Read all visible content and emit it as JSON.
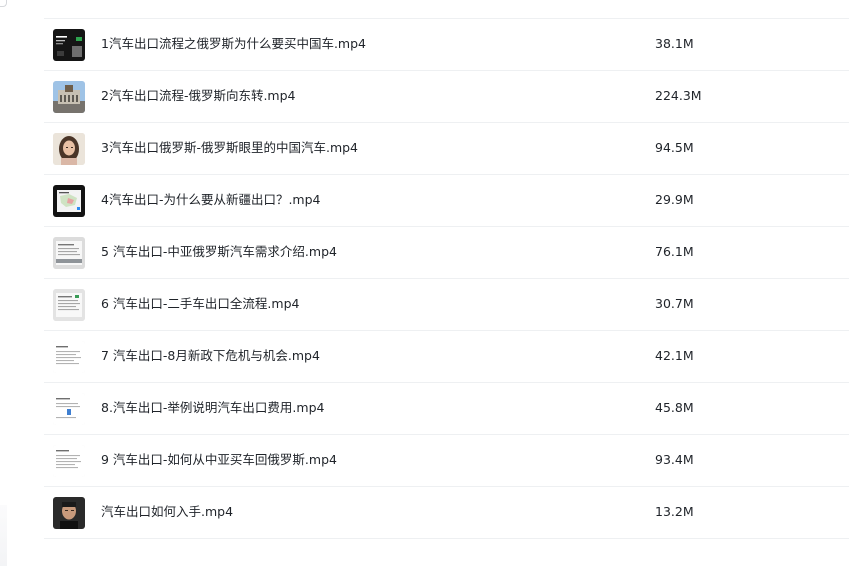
{
  "files": [
    {
      "name": "1汽车出口流程之俄罗斯为什么要买中国车.mp4",
      "size": "38.1M",
      "thumbnail": "dark-slide-thumbnail"
    },
    {
      "name": "2汽车出口流程-俄罗斯向东转.mp4",
      "size": "224.3M",
      "thumbnail": "building-photo-thumbnail"
    },
    {
      "name": "3汽车出口俄罗斯-俄罗斯眼里的中国汽车.mp4",
      "size": "94.5M",
      "thumbnail": "woman-portrait-thumbnail"
    },
    {
      "name": "4汽车出口-为什么要从新疆出口？.mp4",
      "size": "29.9M",
      "thumbnail": "map-slide-thumbnail"
    },
    {
      "name": "5 汽车出口-中亚俄罗斯汽车需求介绍.mp4",
      "size": "76.1M",
      "thumbnail": "document-slide-thumbnail"
    },
    {
      "name": "6 汽车出口-二手车出口全流程.mp4",
      "size": "30.7M",
      "thumbnail": "document-slide-thumbnail"
    },
    {
      "name": "7 汽车出口-8月新政下危机与机会.mp4",
      "size": "42.1M",
      "thumbnail": "text-slide-thumbnail"
    },
    {
      "name": "8.汽车出口-举例说明汽车出口费用.mp4",
      "size": "45.8M",
      "thumbnail": "text-slide-thumbnail"
    },
    {
      "name": "9 汽车出口-如何从中亚买车回俄罗斯.mp4",
      "size": "93.4M",
      "thumbnail": "text-slide-thumbnail"
    },
    {
      "name": "汽车出口如何入手.mp4",
      "size": "13.2M",
      "thumbnail": "man-portrait-thumbnail"
    }
  ]
}
